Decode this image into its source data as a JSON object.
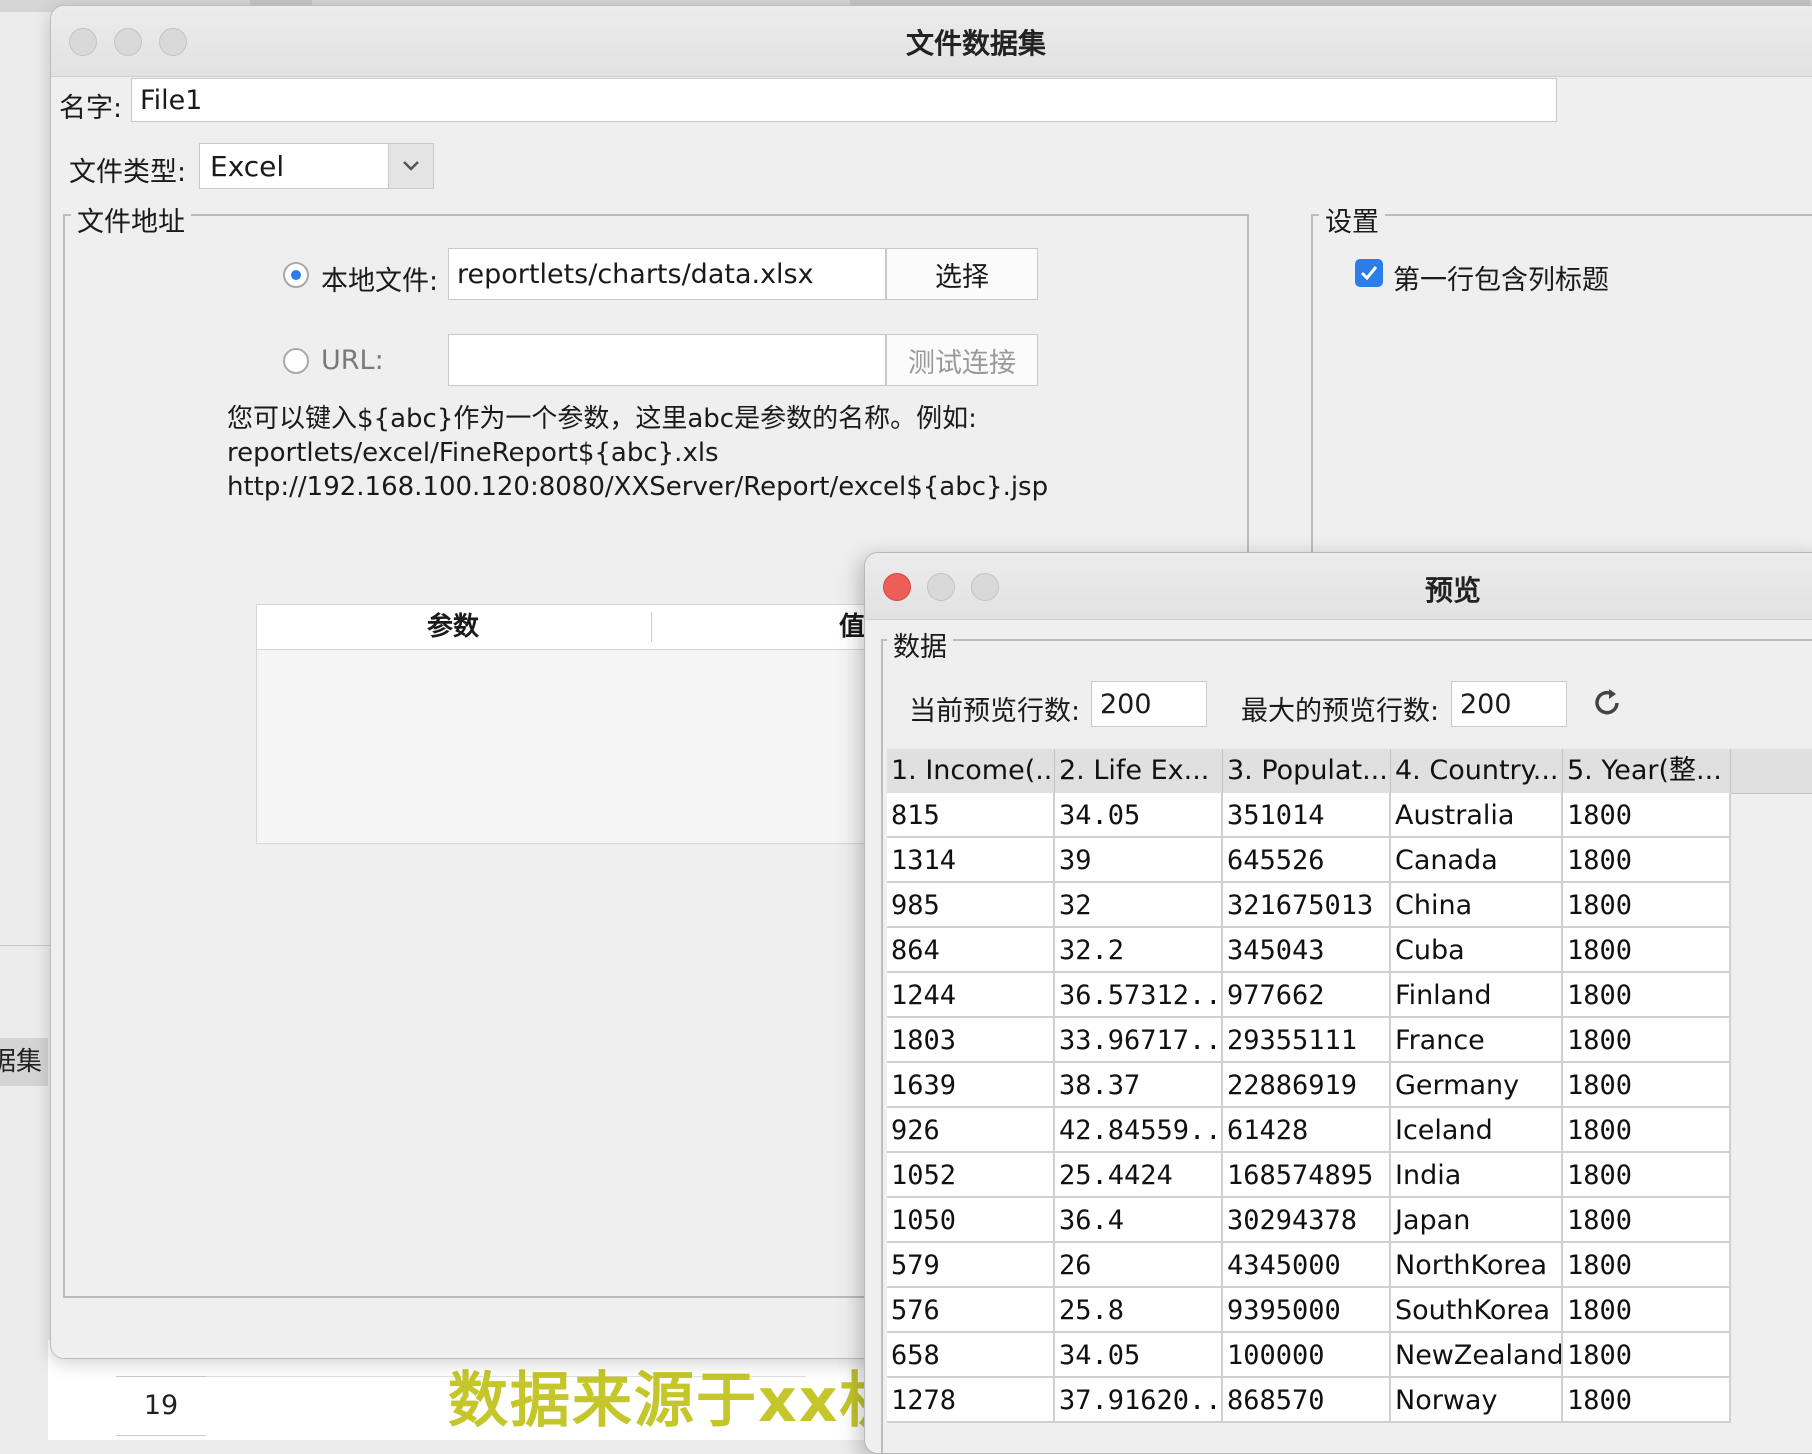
{
  "background": {
    "sidebar_label": "据集",
    "row_number": "19",
    "banner_text": "数据来源于xx机"
  },
  "main_window": {
    "title": "文件数据集",
    "name_label": "名字:",
    "name_value": "File1",
    "file_type_label": "文件类型:",
    "file_type_value": "Excel",
    "file_address_group": "文件地址",
    "local_file_label": "本地文件:",
    "local_file_value": "reportlets/charts/data.xlsx",
    "choose_button": "选择",
    "url_label": "URL:",
    "url_value": "",
    "test_connection_button": "测试连接",
    "hint_lines": [
      "您可以键入${abc}作为一个参数，这里abc是参数的名称。例如:",
      "reportlets/excel/FineReport${abc}.xls",
      "http://192.168.100.120:8080/XXServer/Report/excel${abc}.jsp"
    ],
    "param_table": {
      "col_param": "参数",
      "col_value": "值"
    },
    "settings_group": "设置",
    "first_row_header_label": "第一行包含列标题",
    "first_row_header_checked": true
  },
  "preview_window": {
    "title": "预览",
    "data_group": "数据",
    "current_rows_label": "当前预览行数:",
    "current_rows_value": "200",
    "max_rows_label": "最大的预览行数:",
    "max_rows_value": "200",
    "columns": [
      "1. Income(...",
      "2. Life Ex...",
      "3. Populat...",
      "4. Country...",
      "5. Year(整..."
    ],
    "rows": [
      [
        "815",
        "34.05",
        "351014",
        "Australia",
        "1800"
      ],
      [
        "1314",
        "39",
        "645526",
        "Canada",
        "1800"
      ],
      [
        "985",
        "32",
        "321675013",
        "China",
        "1800"
      ],
      [
        "864",
        "32.2",
        "345043",
        "Cuba",
        "1800"
      ],
      [
        "1244",
        "36.57312...",
        "977662",
        "Finland",
        "1800"
      ],
      [
        "1803",
        "33.96717...",
        "29355111",
        "France",
        "1800"
      ],
      [
        "1639",
        "38.37",
        "22886919",
        "Germany",
        "1800"
      ],
      [
        "926",
        "42.84559...",
        "61428",
        "Iceland",
        "1800"
      ],
      [
        "1052",
        "25.4424",
        "168574895",
        "India",
        "1800"
      ],
      [
        "1050",
        "36.4",
        "30294378",
        "Japan",
        "1800"
      ],
      [
        "579",
        "26",
        "4345000",
        "NorthKorea",
        "1800"
      ],
      [
        "576",
        "25.8",
        "9395000",
        "SouthKorea",
        "1800"
      ],
      [
        "658",
        "34.05",
        "100000",
        "NewZealand",
        "1800"
      ],
      [
        "1278",
        "37.91620...",
        "868570",
        "Norway",
        "1800"
      ]
    ]
  },
  "colors": {
    "accent": "#2b7de9",
    "close_button": "#ec5e57",
    "banner": "#c4c62a"
  }
}
